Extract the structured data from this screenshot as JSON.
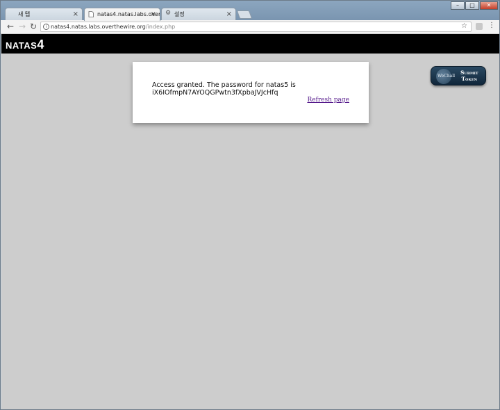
{
  "browser": {
    "tabs": [
      {
        "title": "새 탭",
        "active": false
      },
      {
        "title": "natas4.natas.labs.overthe",
        "active": true
      },
      {
        "title": "설정",
        "active": false
      }
    ],
    "address": {
      "host": "natas4.natas.labs.overthewire.org",
      "path": "/index.php"
    },
    "window_buttons": {
      "minimize": "–",
      "maximize": "□",
      "close": "✕"
    }
  },
  "page": {
    "logo_prefix": "NATAS",
    "logo_number": "4",
    "message_line1": "Access granted. The password for natas5 is",
    "message_line2": "iX6IOfmpN7AYOQGPwtn3fXpbaJVJcHfq",
    "refresh_link": "Refresh page",
    "submit_token": {
      "line1": "Submit",
      "line2": "Token",
      "badge": "WeChall"
    }
  },
  "colors": {
    "page_bg": "#cdcdcd",
    "header_bg": "#000000",
    "link_visited": "#551a8b"
  }
}
